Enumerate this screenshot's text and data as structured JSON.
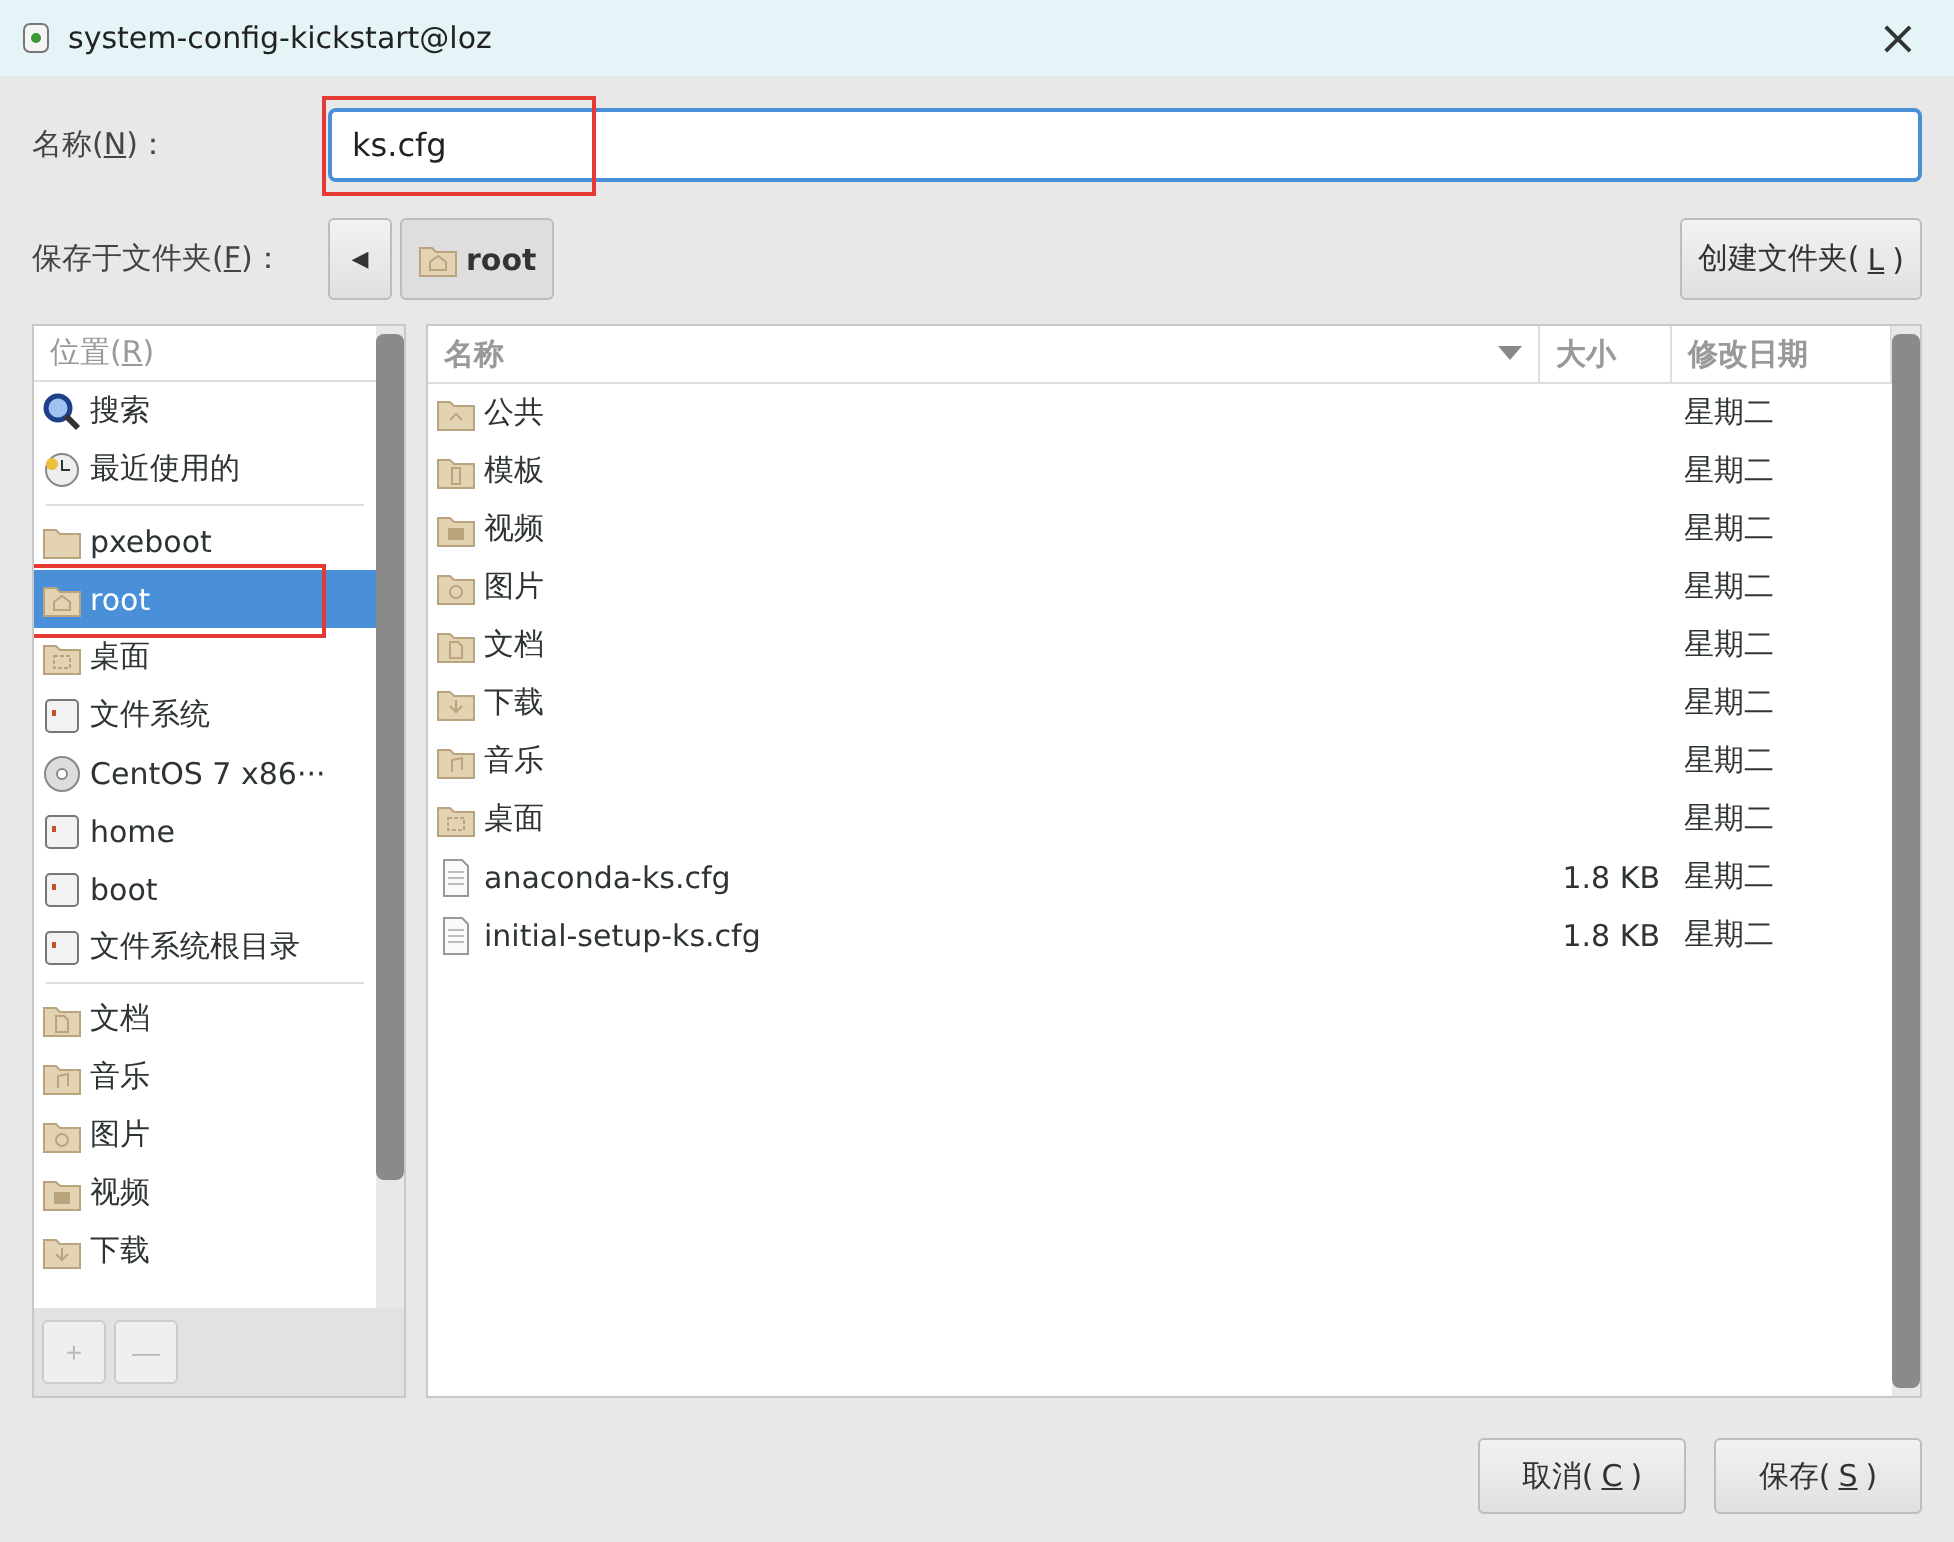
{
  "window": {
    "title": "system-config-kickstart@loz",
    "close": "×"
  },
  "name_field": {
    "label": {
      "before": "名称(",
      "key": "N",
      "after": ")："
    },
    "value": "ks.cfg",
    "annotated": true
  },
  "folder_row": {
    "label": {
      "before": "保存于文件夹(",
      "key": "F",
      "after": ")："
    },
    "back": "◀",
    "path": [
      {
        "label": "root",
        "kind": "home"
      }
    ],
    "create_button": {
      "before": "创建文件夹(",
      "key": "L",
      "after": ")"
    }
  },
  "places": {
    "header": {
      "before": "位置(",
      "key": "R",
      "after": ")"
    },
    "groups": [
      [
        {
          "label": "搜索",
          "kind": "search",
          "selected": false,
          "annotated": false
        },
        {
          "label": "最近使用的",
          "kind": "recent",
          "selected": false,
          "annotated": false
        }
      ],
      [
        {
          "label": "pxeboot",
          "kind": "folder",
          "selected": false,
          "annotated": false
        },
        {
          "label": "root",
          "kind": "home",
          "selected": true,
          "annotated": true
        },
        {
          "label": "桌面",
          "kind": "desktop",
          "selected": false,
          "annotated": false
        },
        {
          "label": "文件系统",
          "kind": "drive",
          "selected": false,
          "annotated": false
        },
        {
          "label": "CentOS 7 x86···",
          "kind": "disc",
          "selected": false,
          "annotated": false
        },
        {
          "label": "home",
          "kind": "drive",
          "selected": false,
          "annotated": false
        },
        {
          "label": "boot",
          "kind": "drive",
          "selected": false,
          "annotated": false
        },
        {
          "label": "文件系统根目录",
          "kind": "drive",
          "selected": false,
          "annotated": false
        }
      ],
      [
        {
          "label": "文档",
          "kind": "documents",
          "selected": false,
          "annotated": false
        },
        {
          "label": "音乐",
          "kind": "music",
          "selected": false,
          "annotated": false
        },
        {
          "label": "图片",
          "kind": "pictures",
          "selected": false,
          "annotated": false
        },
        {
          "label": "视频",
          "kind": "videos",
          "selected": false,
          "annotated": false
        },
        {
          "label": "下载",
          "kind": "downloads",
          "selected": false,
          "annotated": false
        }
      ]
    ],
    "add": "+",
    "remove": "—"
  },
  "files": {
    "columns": [
      "名称",
      "大小",
      "修改日期"
    ],
    "rows": [
      {
        "name": "公共",
        "kind": "public",
        "modified": "星期二"
      },
      {
        "name": "模板",
        "kind": "templates",
        "modified": "星期二"
      },
      {
        "name": "视频",
        "kind": "videos",
        "modified": "星期二"
      },
      {
        "name": "图片",
        "kind": "pictures",
        "modified": "星期二"
      },
      {
        "name": "文档",
        "kind": "documents",
        "modified": "星期二"
      },
      {
        "name": "下载",
        "kind": "downloads",
        "modified": "星期二"
      },
      {
        "name": "音乐",
        "kind": "music",
        "modified": "星期二"
      },
      {
        "name": "桌面",
        "kind": "desktop",
        "modified": "星期二"
      },
      {
        "name": "anaconda-ks.cfg",
        "kind": "file",
        "size": "1.8 KB",
        "modified": "星期二"
      },
      {
        "name": "initial-setup-ks.cfg",
        "kind": "file",
        "size": "1.8 KB",
        "modified": "星期二"
      }
    ]
  },
  "buttons": [
    {
      "before": "取消(",
      "key": "C",
      "after": ")"
    },
    {
      "before": "保存(",
      "key": "S",
      "after": ")"
    }
  ]
}
